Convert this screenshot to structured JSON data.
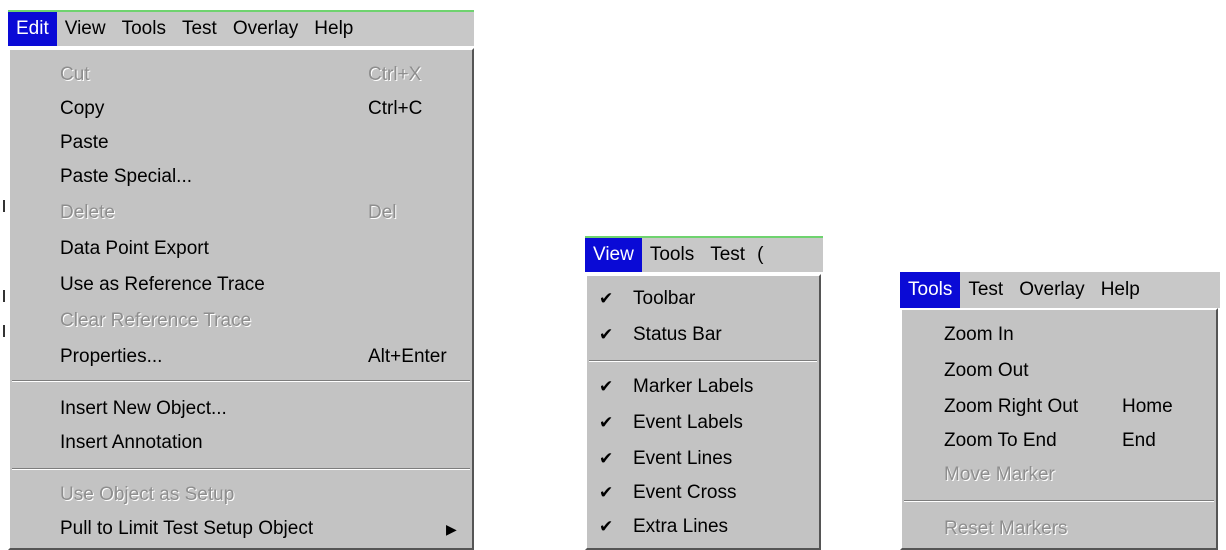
{
  "edit_panel": {
    "menubar": [
      "Edit",
      "View",
      "Tools",
      "Test",
      "Overlay",
      "Help"
    ],
    "items": [
      {
        "label": "Cut",
        "shortcut": "Ctrl+X",
        "disabled": true
      },
      {
        "label": "Copy",
        "shortcut": "Ctrl+C",
        "disabled": false
      },
      {
        "label": "Paste",
        "shortcut": "",
        "disabled": false
      },
      {
        "label": "Paste Special...",
        "shortcut": "",
        "disabled": false
      },
      {
        "label": "Delete",
        "shortcut": "Del",
        "disabled": true
      },
      {
        "label": "Data Point Export",
        "shortcut": "",
        "disabled": false
      },
      {
        "label": "Use as Reference Trace",
        "shortcut": "",
        "disabled": false
      },
      {
        "label": "Clear Reference Trace",
        "shortcut": "",
        "disabled": true
      },
      {
        "label": "Properties...",
        "shortcut": "Alt+Enter",
        "disabled": false
      },
      {
        "label": "Insert New Object...",
        "shortcut": "",
        "disabled": false
      },
      {
        "label": "Insert Annotation",
        "shortcut": "",
        "disabled": false
      },
      {
        "label": "Use Object as Setup",
        "shortcut": "",
        "disabled": true
      },
      {
        "label": "Pull to Limit Test Setup Object",
        "shortcut": "",
        "disabled": false,
        "submenu": true
      }
    ]
  },
  "view_panel": {
    "menubar": [
      "View",
      "Tools",
      "Test",
      "("
    ],
    "items": [
      {
        "label": "Toolbar",
        "checked": true
      },
      {
        "label": "Status Bar",
        "checked": true
      },
      {
        "label": "Marker Labels",
        "checked": true
      },
      {
        "label": "Event Labels",
        "checked": true
      },
      {
        "label": "Event Lines",
        "checked": true
      },
      {
        "label": "Event Cross",
        "checked": true
      },
      {
        "label": "Extra Lines",
        "checked": true
      }
    ]
  },
  "tools_panel": {
    "menubar": [
      "Tools",
      "Test",
      "Overlay",
      "Help"
    ],
    "items": [
      {
        "label": "Zoom In",
        "shortcut": "",
        "disabled": false
      },
      {
        "label": "Zoom Out",
        "shortcut": "",
        "disabled": false
      },
      {
        "label": "Zoom Right Out",
        "shortcut": "Home",
        "disabled": false
      },
      {
        "label": "Zoom To End",
        "shortcut": "End",
        "disabled": false
      },
      {
        "label": "Move Marker",
        "shortcut": "",
        "disabled": true
      },
      {
        "label": "Reset Markers",
        "shortcut": "",
        "disabled": true
      }
    ]
  },
  "check_glyph": "✔",
  "submenu_glyph": "▶"
}
